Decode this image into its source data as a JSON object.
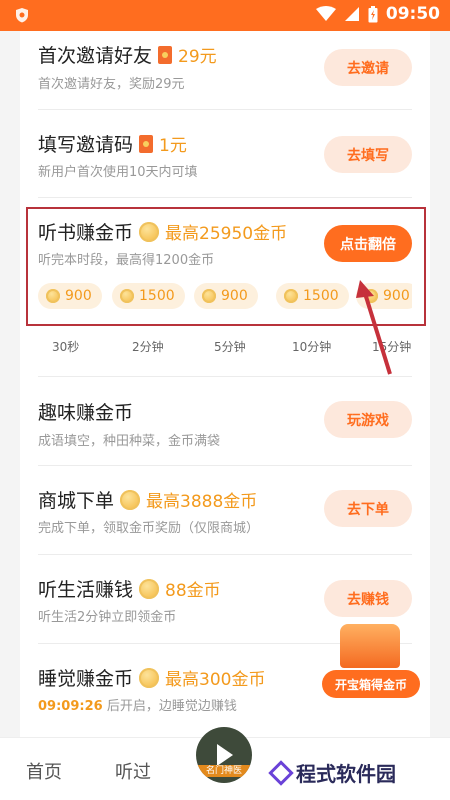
{
  "status": {
    "time": "09:50"
  },
  "tasks": [
    {
      "title": "首次邀请好友",
      "reward": "29元",
      "desc": "首次邀请好友，奖励29元",
      "button": "去邀请"
    },
    {
      "title": "填写邀请码",
      "reward": "1元",
      "desc": "新用户首次使用10天内可填",
      "button": "去填写"
    },
    {
      "title": "听书赚金币",
      "reward": "最高25950金币",
      "desc": "听完本时段，最高得1200金币",
      "button": "点击翻倍"
    },
    {
      "title": "趣味赚金币",
      "desc": "成语填空，种田种菜，金币满袋",
      "button": "玩游戏"
    },
    {
      "title": "商城下单",
      "reward": "最高3888金币",
      "desc": "完成下单，领取金币奖励（仅限商城）",
      "button": "去下单"
    },
    {
      "title": "听生活赚钱",
      "reward": "88金币",
      "desc": "听生活2分钟立即领金币",
      "button": "去赚钱"
    },
    {
      "title": "睡觉赚金币",
      "reward": "最高300金币",
      "countdown": "09:09:26",
      "desc": "后开启，边睡觉边赚钱"
    }
  ],
  "listen_rewards": [
    {
      "amount": "900",
      "time": "30秒"
    },
    {
      "amount": "1500",
      "time": "2分钟"
    },
    {
      "amount": "900",
      "time": "5分钟"
    },
    {
      "amount": "1500",
      "time": "10分钟"
    },
    {
      "amount": "900",
      "time": "15分钟"
    }
  ],
  "treasure": {
    "label": "开宝箱得金币"
  },
  "nav": {
    "home": "首页",
    "listened": "听过",
    "cover_text": "名门神医"
  },
  "watermark": "程式软件园",
  "colors": {
    "accent": "#ff6d1f",
    "gold": "#f39a1d",
    "highlight_border": "#b8323b"
  }
}
